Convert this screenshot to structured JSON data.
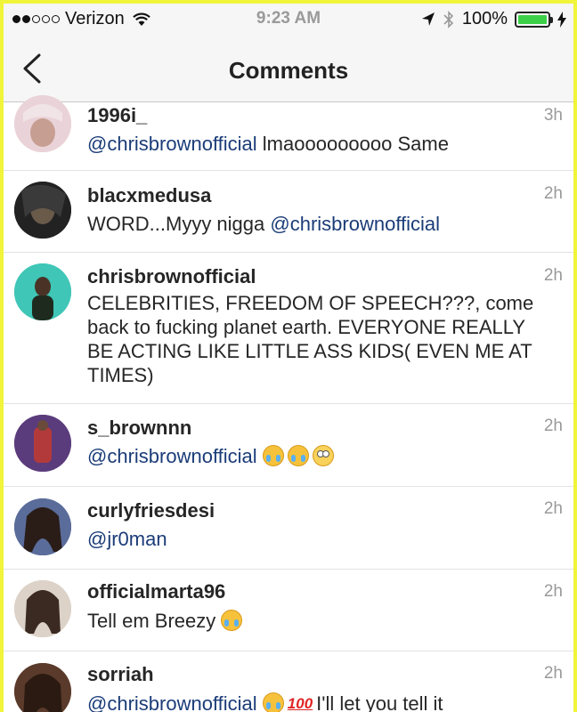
{
  "status_bar": {
    "carrier": "Verizon",
    "signal_dots_filled": 2,
    "signal_dots_total": 5,
    "time": "9:23 AM",
    "battery": "100%",
    "battery_color": "#3bd047"
  },
  "navbar": {
    "title": "Comments",
    "back_icon": "chevron-left-icon"
  },
  "colors": {
    "mention": "#1b3c78",
    "timestamp": "#9a9a9a",
    "frame_border": "#f1f53a"
  },
  "comments": [
    {
      "username": "1996i_",
      "time": "3h",
      "mention": "@chrisbrownofficial",
      "text": "lmaooooooooo Same",
      "avatar_color": "#e8c7cf"
    },
    {
      "username": "blacxmedusa",
      "time": "2h",
      "text": "WORD...Myyy nigga",
      "mention": "@chrisbrownofficial",
      "avatar_color": "#2a2a2a"
    },
    {
      "username": "chrisbrownofficial",
      "time": "2h",
      "text": "CELEBRITIES, FREEDOM OF SPEECH???, come back to fucking planet earth. EVERYONE REALLY BE ACTING LIKE LITTLE ASS KIDS( EVEN ME AT TIMES)",
      "avatar_color": "#3fc6b6"
    },
    {
      "username": "s_brownnn",
      "time": "2h",
      "mention": "@chrisbrownofficial",
      "emojis": [
        "face-with-tears-of-joy",
        "face-with-tears-of-joy",
        "face-with-rolling-eyes"
      ],
      "avatar_color": "#7a4a8c"
    },
    {
      "username": "curlyfriesdesi",
      "time": "2h",
      "mention": "@jr0man",
      "avatar_color": "#4a5a8a"
    },
    {
      "username": "officialmarta96",
      "time": "2h",
      "text": "Tell em Breezy",
      "emojis": [
        "face-with-tears-of-joy"
      ],
      "avatar_color": "#c9b9a8"
    },
    {
      "username": "sorriah",
      "time": "2h",
      "mention": "@chrisbrownofficial",
      "emojis": [
        "face-with-tears-of-joy",
        "hundred-points"
      ],
      "text": "I'll let you tell it",
      "avatar_color": "#6b4a3a"
    }
  ]
}
